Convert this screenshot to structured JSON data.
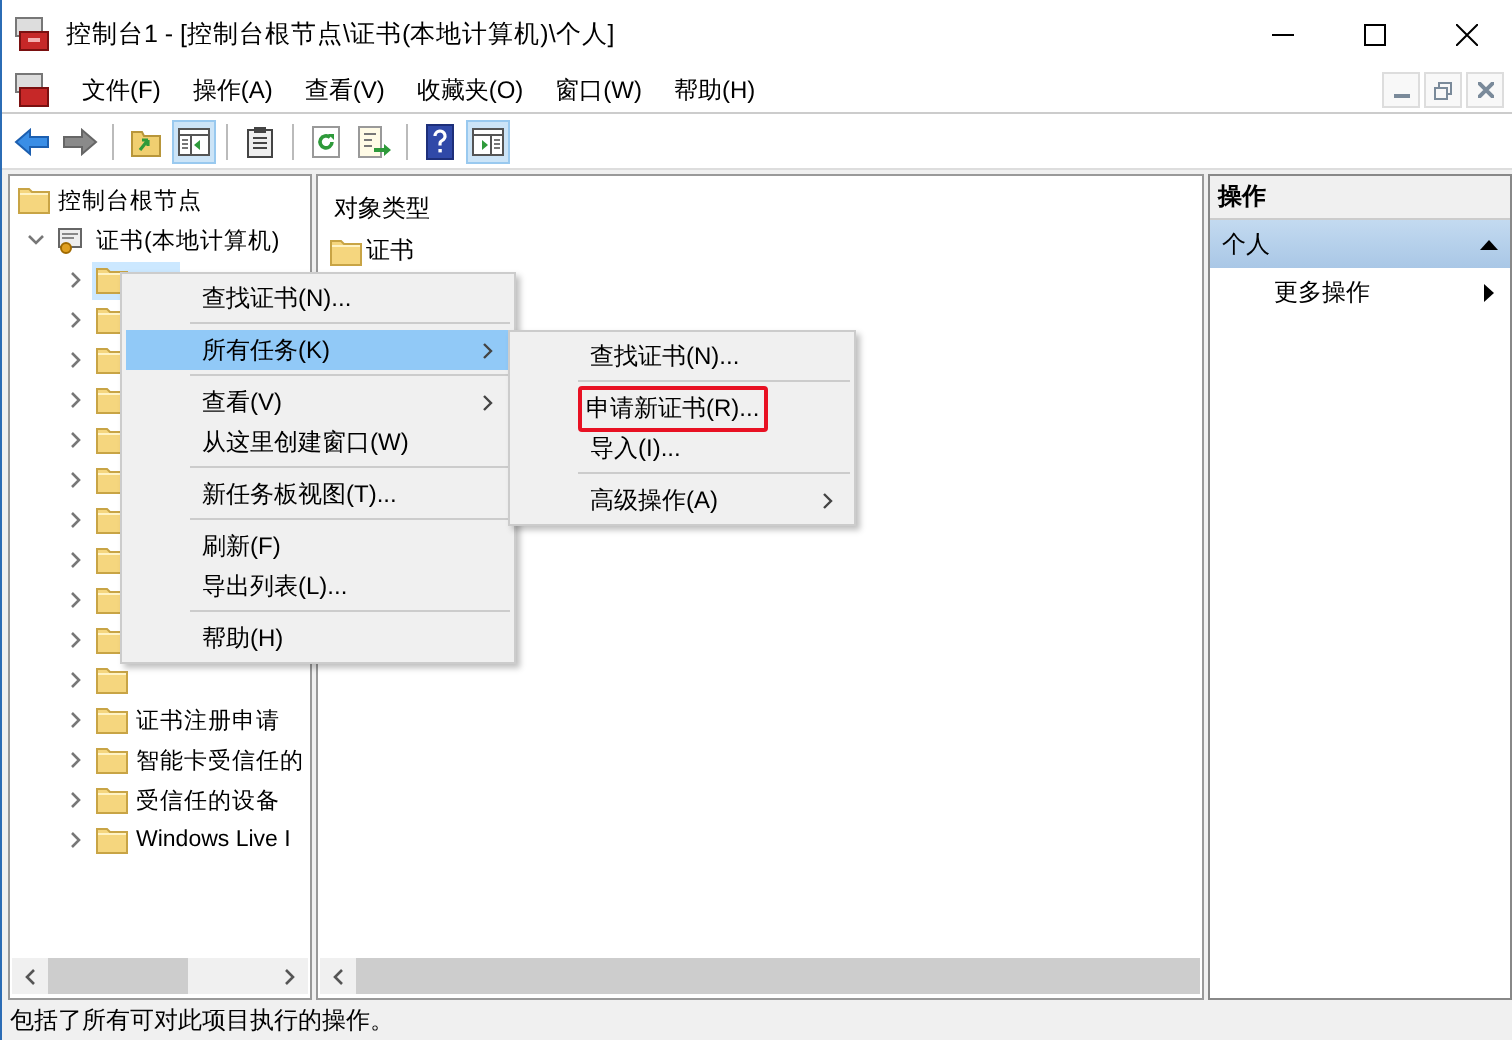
{
  "window": {
    "title": "控制台1 - [控制台根节点\\证书(本地计算机)\\个人]"
  },
  "menu_bar": [
    "文件(F)",
    "操作(A)",
    "查看(V)",
    "收藏夹(O)",
    "窗口(W)",
    "帮助(H)"
  ],
  "toolbar": [
    {
      "kind": "back",
      "on": false
    },
    {
      "kind": "forward",
      "on": false
    },
    {
      "kind": "separator"
    },
    {
      "kind": "up",
      "on": false
    },
    {
      "kind": "tree",
      "on": true
    },
    {
      "kind": "separator"
    },
    {
      "kind": "properties",
      "on": false
    },
    {
      "kind": "separator"
    },
    {
      "kind": "refresh",
      "on": false
    },
    {
      "kind": "export",
      "on": false
    },
    {
      "kind": "separator"
    },
    {
      "kind": "help",
      "on": false
    },
    {
      "kind": "actions",
      "on": true
    }
  ],
  "tree": {
    "label": "控制台根节点",
    "children": [
      {
        "label": "证书(本地计算机)",
        "expanded": true,
        "selected": false,
        "children": [
          {
            "selected": true
          },
          {
            "selected": false
          },
          {
            "selected": false
          },
          {
            "selected": false
          },
          {
            "selected": false
          },
          {
            "selected": false
          },
          {
            "selected": false
          },
          {
            "selected": false
          },
          {
            "selected": false
          },
          {
            "selected": false
          },
          {
            "selected": false
          },
          {
            "label": "证书注册申请",
            "selected": false
          },
          {
            "label": "智能卡受信任的",
            "selected": false
          },
          {
            "label": "受信任的设备",
            "selected": false
          },
          {
            "label": "Windows Live I",
            "selected": false
          }
        ]
      }
    ]
  },
  "center": {
    "header": "对象类型",
    "items": [
      "证书"
    ]
  },
  "actions": {
    "header": "操作",
    "section": {
      "label": "个人",
      "expanded": true
    },
    "items": [
      "更多操作"
    ]
  },
  "context_menu": {
    "items": [
      {
        "kind": "item",
        "label": "查找证书(N)...",
        "submenu": false,
        "selected": false
      },
      {
        "kind": "separator"
      },
      {
        "kind": "item",
        "label": "所有任务(K)",
        "submenu": true,
        "selected": true
      },
      {
        "kind": "separator"
      },
      {
        "kind": "item",
        "label": "查看(V)",
        "submenu": true,
        "selected": false
      },
      {
        "kind": "item",
        "label": "从这里创建窗口(W)",
        "submenu": false,
        "selected": false
      },
      {
        "kind": "separator"
      },
      {
        "kind": "item",
        "label": "新任务板视图(T)...",
        "submenu": false,
        "selected": false
      },
      {
        "kind": "separator"
      },
      {
        "kind": "item",
        "label": "刷新(F)",
        "submenu": false,
        "selected": false
      },
      {
        "kind": "item",
        "label": "导出列表(L)...",
        "submenu": false,
        "selected": false
      },
      {
        "kind": "separator"
      },
      {
        "kind": "item",
        "label": "帮助(H)",
        "submenu": false,
        "selected": false
      }
    ]
  },
  "submenu": {
    "items": [
      {
        "kind": "item",
        "label": "查找证书(N)...",
        "submenu": false,
        "outlined": false
      },
      {
        "kind": "separator"
      },
      {
        "kind": "item",
        "label": "申请新证书(R)...",
        "submenu": false,
        "outlined": true
      },
      {
        "kind": "item",
        "label": "导入(I)...",
        "submenu": false,
        "outlined": false
      },
      {
        "kind": "separator"
      },
      {
        "kind": "item",
        "label": "高级操作(A)",
        "submenu": true,
        "outlined": false
      }
    ]
  },
  "status_bar": "包括了所有可对此项目执行的操作。"
}
